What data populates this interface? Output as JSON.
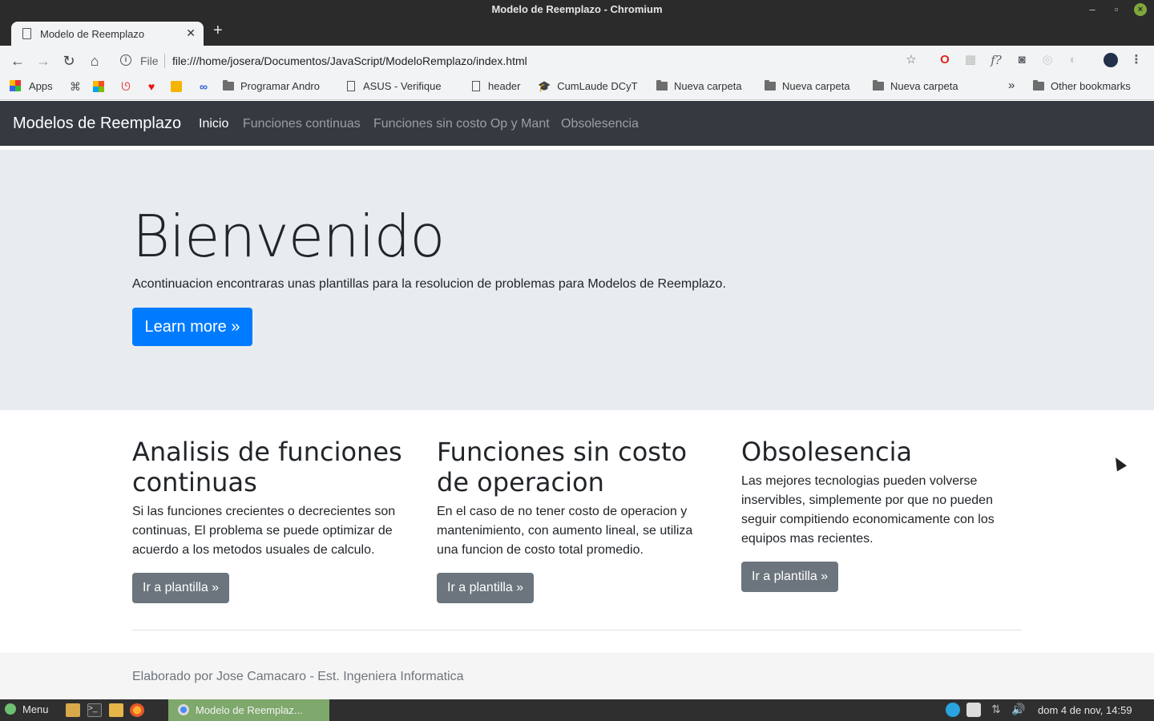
{
  "window": {
    "title": "Modelo de Reemplazo - Chromium"
  },
  "tab": {
    "title": "Modelo de Reemplazo"
  },
  "address": {
    "scheme": "File",
    "url": "file:///home/josera/Documentos/JavaScript/ModeloRemplazo/index.html"
  },
  "bookmarks": {
    "apps": "Apps",
    "items": [
      "Programar Andro",
      "ASUS - Verifique",
      "header",
      "CumLaude DCyT",
      "Nueva carpeta",
      "Nueva carpeta",
      "Nueva carpeta"
    ],
    "more": "»",
    "other": "Other bookmarks"
  },
  "navbar": {
    "brand": "Modelos de Reemplazo",
    "links": [
      "Inicio",
      "Funciones continuas",
      "Funciones sin costo Op y Mant",
      "Obsolesencia"
    ]
  },
  "hero": {
    "title": "Bienvenido",
    "text": "Acontinuacion encontraras unas plantillas para la resolucion de problemas para Modelos de Reemplazo.",
    "button": "Learn more »"
  },
  "columns": [
    {
      "title": "Analisis de funciones continuas",
      "text": "Si las funciones crecientes o decrecientes son continuas, El problema se puede optimizar de acuerdo a los metodos usuales de calculo.",
      "button": "Ir a plantilla »"
    },
    {
      "title": "Funciones sin costo de operacion",
      "text": "En el caso de no tener costo de operacion y mantenimiento, con aumento lineal, se utiliza una funcion de costo total promedio.",
      "button": "Ir a plantilla »"
    },
    {
      "title": "Obsolesencia",
      "text": "Las mejores tecnologias pueden volverse inservibles, simplemente por que no pueden seguir compitiendo economicamente con los equipos mas recientes.",
      "button": "Ir a plantilla »"
    }
  ],
  "footer": {
    "text": "Elaborado por Jose Camacaro - Est. Ingeniera Informatica"
  },
  "taskbar": {
    "menu": "Menu",
    "window": "Modelo de Reemplaz...",
    "clock": "dom  4 de nov, 14:59"
  },
  "colors": {
    "navbar": "#343a40",
    "primary": "#007bff",
    "secondary": "#6c757d",
    "jumbotron": "#e9ecef"
  }
}
